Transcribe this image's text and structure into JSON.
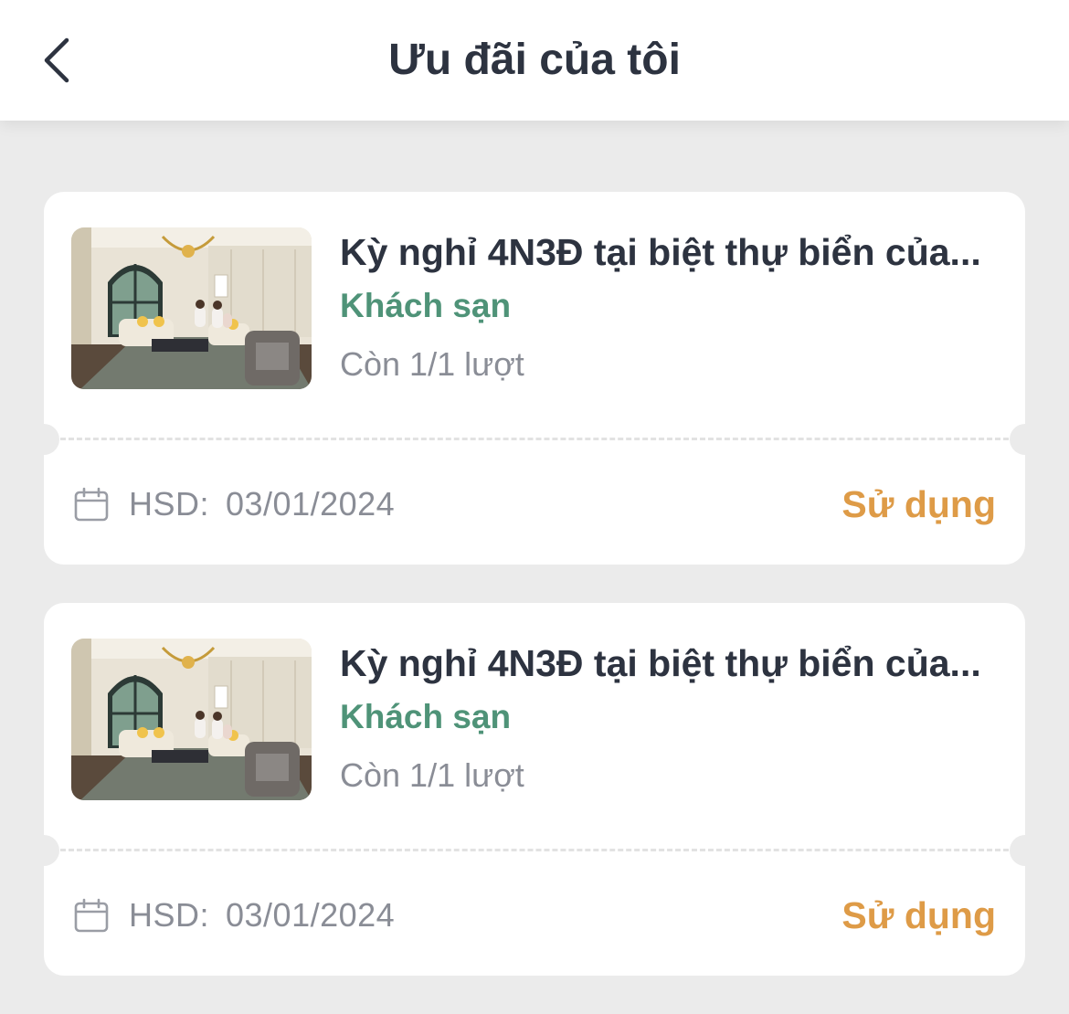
{
  "header": {
    "title": "Ưu đãi của tôi",
    "back_icon": "chevron-left-icon"
  },
  "colors": {
    "background": "#ebebeb",
    "card": "#ffffff",
    "title_text": "#2d3340",
    "category": "#4f9378",
    "muted": "#8a8d96",
    "action": "#de9b47"
  },
  "vouchers": [
    {
      "title": "Kỳ nghỉ 4N3Đ tại biệt thự biển của...",
      "category": "Khách sạn",
      "remaining": "Còn 1/1 lượt",
      "expiry_label": "HSD:",
      "expiry_date": "03/01/2024",
      "action": "Sử dụng",
      "expiry_icon": "calendar-icon"
    },
    {
      "title": "Kỳ nghỉ 4N3Đ tại biệt thự biển của...",
      "category": "Khách sạn",
      "remaining": "Còn 1/1 lượt",
      "expiry_label": "HSD:",
      "expiry_date": "03/01/2024",
      "action": "Sử dụng",
      "expiry_icon": "calendar-icon"
    }
  ]
}
